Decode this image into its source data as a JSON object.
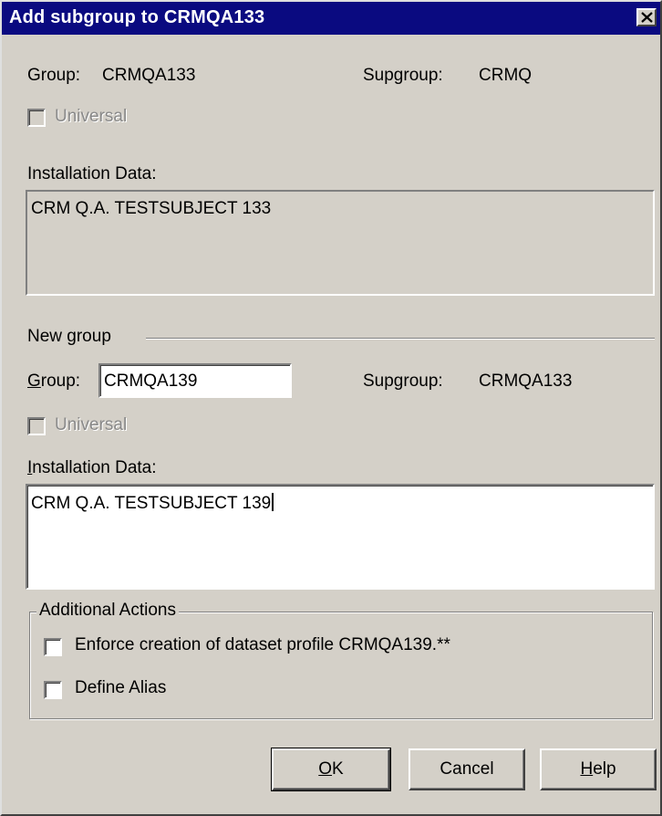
{
  "window": {
    "title": "Add subgroup to CRMQA133"
  },
  "existing": {
    "group_label": "Group:",
    "group_value": "CRMQA133",
    "supgroup_label": "Supgroup:",
    "supgroup_value": "CRMQ",
    "universal_label": "Universal",
    "installation_label": "Installation Data:",
    "installation_value": "CRM Q.A. TESTSUBJECT 133"
  },
  "new_group": {
    "section_label": "New group",
    "group_label_u": "G",
    "group_label_rest": "roup:",
    "group_value": "CRMQA139",
    "supgroup_label": "Supgroup:",
    "supgroup_value": "CRMQA133",
    "universal_label": "Universal",
    "installation_label_u": "I",
    "installation_label_rest": "nstallation Data:",
    "installation_value": "CRM Q.A. TESTSUBJECT 139"
  },
  "additional_actions": {
    "label": "Additional Actions",
    "enforce_label": "Enforce creation of dataset profile CRMQA139.**",
    "alias_label": "Define Alias"
  },
  "buttons": {
    "ok_u": "O",
    "ok_rest": "K",
    "cancel": "Cancel",
    "help_u": "H",
    "help_rest": "elp"
  }
}
